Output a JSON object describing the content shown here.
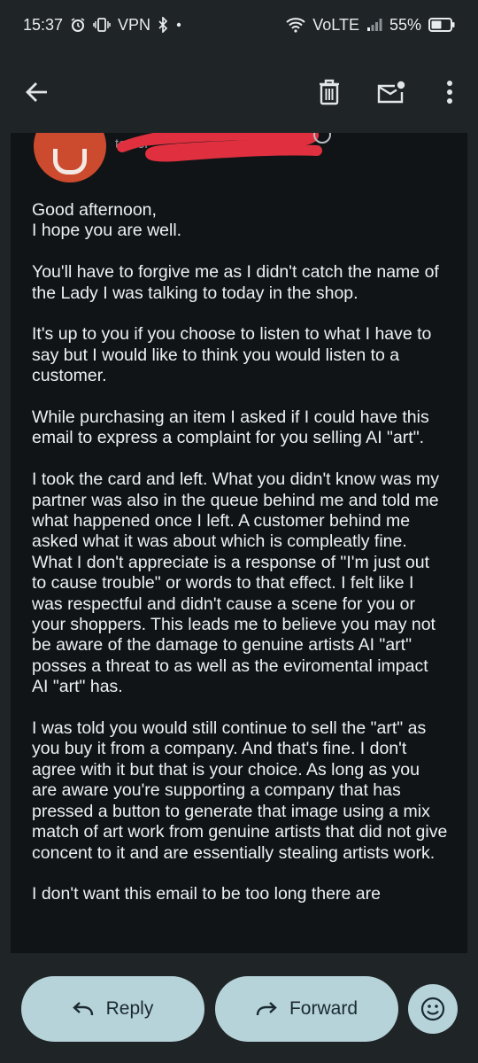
{
  "status_bar": {
    "time": "15:37",
    "vpn": "VPN",
    "volte": "VoLTE",
    "battery": "55%",
    "battery_level": 0.55
  },
  "toolbar": {
    "back_icon": "arrow-left-icon",
    "delete_icon": "trash-icon",
    "mark_unread_icon": "mail-dot-icon",
    "more_icon": "more-vertical-icon"
  },
  "email": {
    "sender_partial": "to dei",
    "paragraphs": [
      "Good afternoon,\nI hope you are well.",
      "You'll have to forgive me as I didn't catch the name of the Lady I was talking to today in the shop.",
      "It's up to you if you choose to listen to what I have to say but I would like to think you would listen to a customer.",
      "While purchasing an item I asked if I could have this email to express a complaint for you selling AI \"art\".",
      "I took the card and left. What you didn't know was my partner was also in the queue behind me and told me what happened once I left. A customer behind me asked what it was about which is compleatly fine. What I don't appreciate is a response of \"I'm just out to cause trouble\" or words to that effect. I felt like I was respectful and didn't cause a scene for you or your shoppers. This leads me to believe you may not be aware of the damage to genuine artists AI \"art\" posses a threat to as well as the eviromental impact AI \"art\" has.",
      "I was told you would still continue to sell the \"art\" as you buy it from a company. And that's fine. I don't agree with it but that is your choice. As long as you are aware you're supporting a company that has pressed a button to generate that image using a mix match of art work from genuine artists that did not give concent to it and are essentially stealing artists work.",
      "I don't want this email to be too long there are"
    ]
  },
  "actions": {
    "reply_label": "Reply",
    "forward_label": "Forward",
    "emoji_icon": "emoji-smile-icon"
  },
  "colors": {
    "background": "#1f2427",
    "email_panel": "#101416",
    "pill": "#b6d3d9",
    "avatar": "#cc4b2e",
    "redaction": "#e0303f"
  }
}
